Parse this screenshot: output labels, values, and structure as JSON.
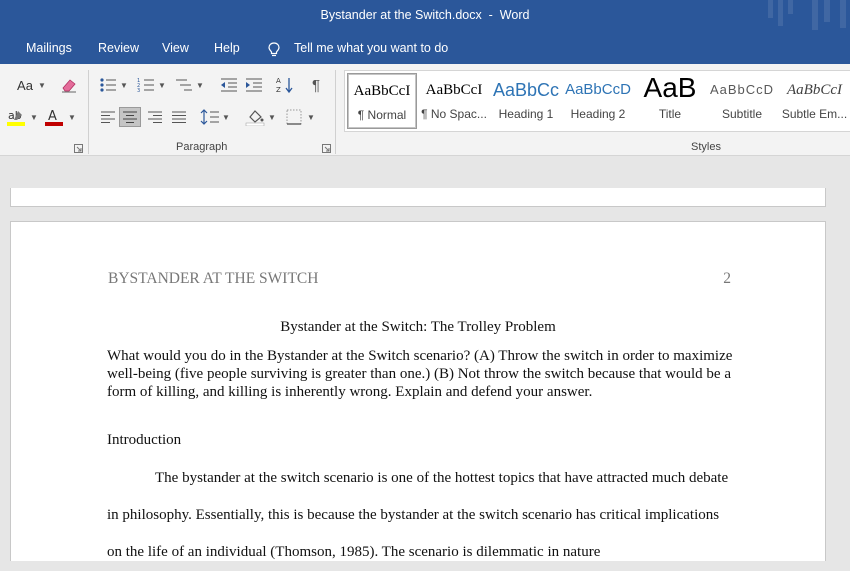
{
  "window": {
    "title": "Bystander at the Switch.docx  -  Word"
  },
  "menu": {
    "items": [
      "Mailings",
      "Review",
      "View",
      "Help"
    ],
    "tell_me": "Tell me what you want to do"
  },
  "ribbon": {
    "font_case_label": "Aa",
    "paragraph_label": "Paragraph",
    "styles_label": "Styles",
    "pilcrow": "¶",
    "styles": [
      {
        "preview": "AaBbCcI",
        "name": "¶ Normal",
        "color": "#000000"
      },
      {
        "preview": "AaBbCcI",
        "name": "¶ No Spac...",
        "color": "#000000"
      },
      {
        "preview": "AaBbCc",
        "name": "Heading 1",
        "color": "#2e74b5"
      },
      {
        "preview": "AaBbCcD",
        "name": "Heading 2",
        "color": "#2e74b5"
      },
      {
        "preview": "AaB",
        "name": "Title",
        "color": "#000000"
      },
      {
        "preview": "AaBbCcD",
        "name": "Subtitle",
        "color": "#595959"
      },
      {
        "preview": "AaBbCcI",
        "name": "Subtle Em...",
        "color": "#404040"
      }
    ],
    "icons": [
      "highlight-icon",
      "font-color-icon",
      "clear-formatting-icon",
      "bullets-icon",
      "numbering-icon",
      "multilevel-list-icon",
      "decrease-indent-icon",
      "increase-indent-icon",
      "sort-icon",
      "show-marks-icon",
      "align-left-icon",
      "align-center-icon",
      "align-right-icon",
      "justify-icon",
      "line-spacing-icon",
      "shading-icon",
      "borders-icon",
      "dialog-launcher-icon"
    ]
  },
  "document": {
    "header_text": "BYSTANDER AT THE SWITCH",
    "page_number": "2",
    "title": "Bystander at the Switch: The Trolley Problem",
    "question": "What would you do in the Bystander at the Switch scenario? (A) Throw the switch in order to maximize well-being (five people surviving is greater than one.) (B) Not throw the switch because that would be a form of killing, and killing is inherently wrong. Explain and defend your answer.",
    "intro_heading": "Introduction",
    "body": "The bystander at the switch scenario is one of the hottest topics that have attracted much debate in philosophy. Essentially, this is because the bystander at the switch scenario has critical implications on the life of an individual (Thomson, 1985). The scenario is dilemmatic in nature"
  },
  "colors": {
    "titlebar": "#2b579a",
    "ribbon": "#f3f3f3",
    "workspace": "#e6e6e6",
    "highlight": "#ffff00",
    "font_color": "#c00000"
  }
}
